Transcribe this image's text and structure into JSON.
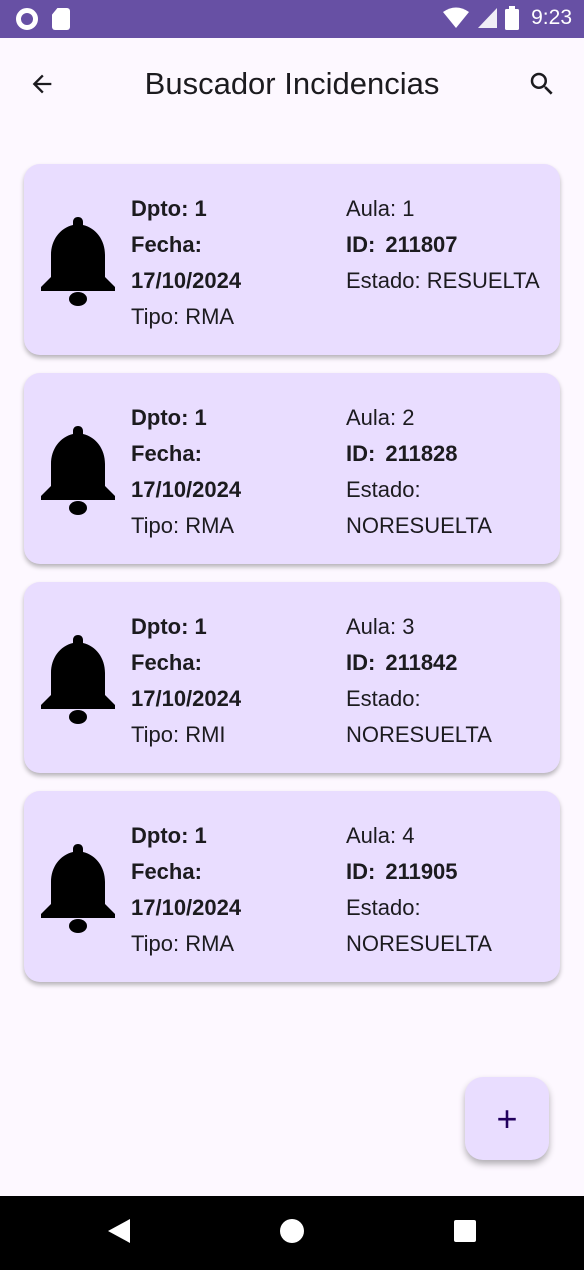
{
  "status_bar": {
    "time": "9:23",
    "icons": [
      "ring-icon",
      "sd-card-icon",
      "wifi-icon",
      "signal-icon",
      "battery-icon"
    ]
  },
  "app_bar": {
    "title": "Buscador Incidencias",
    "back_icon": "arrow-left-icon",
    "search_icon": "search-icon"
  },
  "labels": {
    "dpto": "Dpto:",
    "fecha": "Fecha:",
    "tipo": "Tipo:",
    "aula": "Aula:",
    "id": "ID:",
    "estado": "Estado:"
  },
  "incidencias": [
    {
      "dpto": "1",
      "fecha": "17/10/2024",
      "tipo": "RMA",
      "aula": "1",
      "id": "211807",
      "estado": "RESUELTA"
    },
    {
      "dpto": "1",
      "fecha": "17/10/2024",
      "tipo": "RMA",
      "aula": "2",
      "id": "211828",
      "estado": "NORESUELTA"
    },
    {
      "dpto": "1",
      "fecha": "17/10/2024",
      "tipo": "RMI",
      "aula": "3",
      "id": "211842",
      "estado": "NORESUELTA"
    },
    {
      "dpto": "1",
      "fecha": "17/10/2024",
      "tipo": "RMA",
      "aula": "4",
      "id": "211905",
      "estado": "NORESUELTA"
    }
  ],
  "fab": {
    "label": "+",
    "icon": "plus-icon"
  },
  "colors": {
    "status_bar": "#6750a4",
    "card_bg": "#e9ddff",
    "background": "#fdf8ff",
    "fab_icon": "#21005d"
  }
}
